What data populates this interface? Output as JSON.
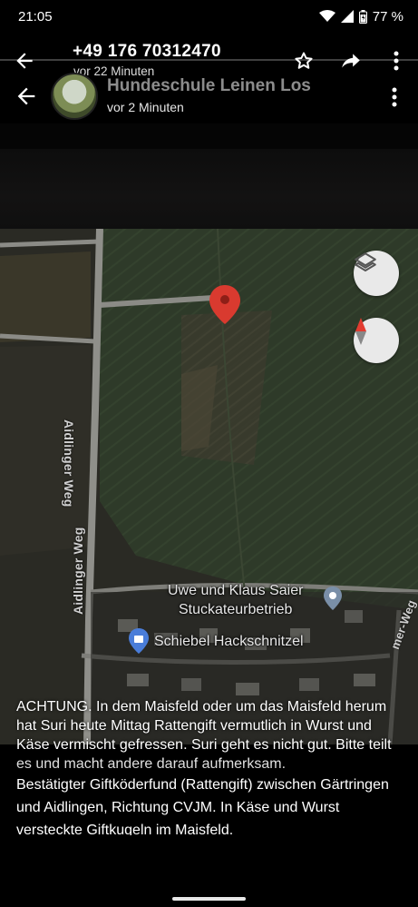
{
  "status_bar": {
    "time": "21:05",
    "battery": "77 %"
  },
  "chat_header": {
    "title": "+49 176 70312470",
    "subtitle": "vor 22 Minuten"
  },
  "story_header": {
    "title": "Hundeschule Leinen Los",
    "subtitle": "vor 2 Minuten"
  },
  "map": {
    "road_labels": [
      "Aidlinger Weg",
      "Aidlinger Weg",
      "mer-Weg"
    ],
    "poi": [
      {
        "line1": "Uwe und Klaus Saier",
        "line2": "Stuckateurbetrieb"
      },
      {
        "line1": "Schiebel Hackschnitzel"
      }
    ],
    "pin_color": "#d93a2f"
  },
  "caption_overlay": "ACHTUNG. In dem Maisfeld oder um das Maisfeld herum hat Suri heute Mittag Rattengift vermutlich in Wurst und Käse vermischt gefressen. Suri geht es nicht gut. Bitte teilt es und macht andere darauf aufmerksam.",
  "caption_main": "Bestätigter Giftköderfund (Rattengift) zwischen Gärtringen und Aidlingen, Richtung CVJM. In Käse und Wurst versteckte Giftkugeln im Maisfeld."
}
